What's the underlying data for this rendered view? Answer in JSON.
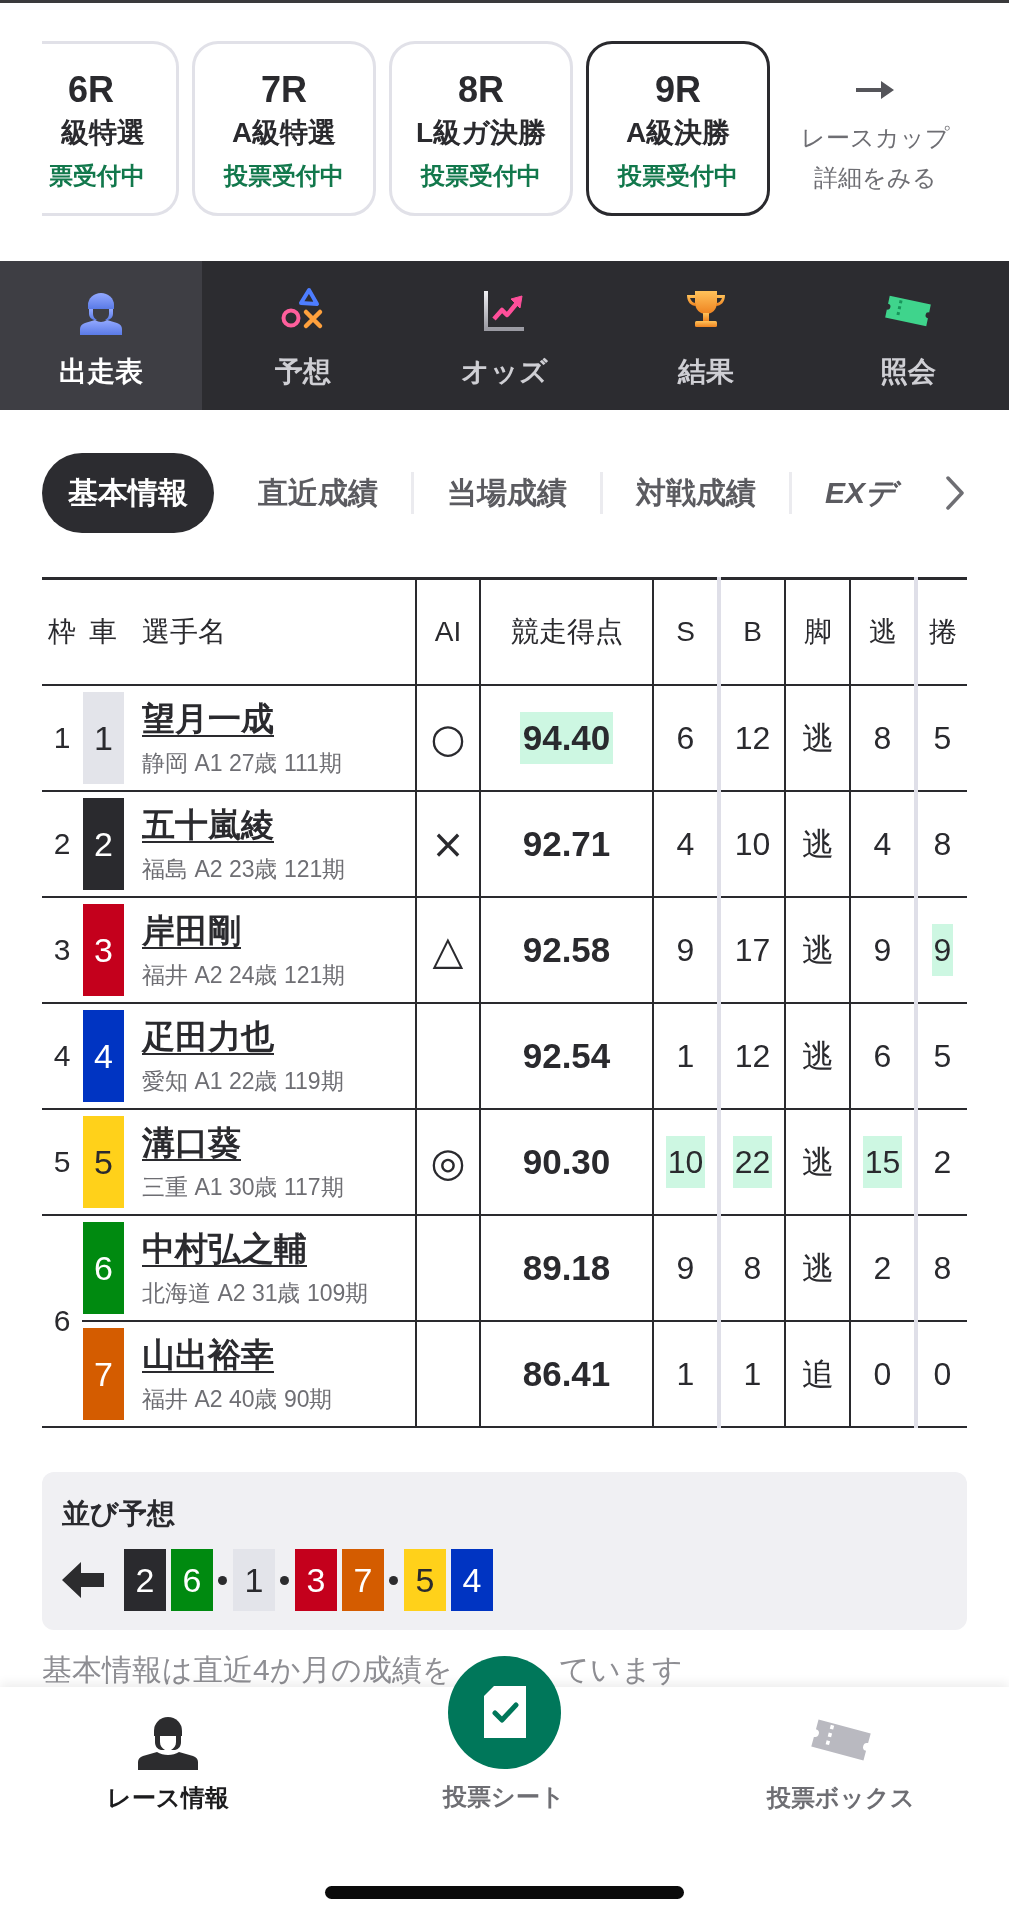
{
  "race_selector": {
    "cards": [
      {
        "race": "6R",
        "class": "級特選",
        "status": "票受付中",
        "selected": false
      },
      {
        "race": "7R",
        "class": "A級特選",
        "status": "投票受付中",
        "selected": false
      },
      {
        "race": "8R",
        "class": "L級ガ決勝",
        "status": "投票受付中",
        "selected": false
      },
      {
        "race": "9R",
        "class": "A級決勝",
        "status": "投票受付中",
        "selected": true
      }
    ],
    "link": "レースカップ詳細をみる"
  },
  "main_tabs": [
    {
      "label": "出走表",
      "selected": true
    },
    {
      "label": "予想",
      "selected": false
    },
    {
      "label": "オッズ",
      "selected": false
    },
    {
      "label": "結果",
      "selected": false
    },
    {
      "label": "照会",
      "selected": false
    }
  ],
  "sub_tabs": [
    {
      "label": "基本情報",
      "kind": "text",
      "selected": true
    },
    {
      "label": "直近成績",
      "kind": "text",
      "selected": false
    },
    {
      "label": "当場成績",
      "kind": "text",
      "selected": false
    },
    {
      "label": "対戦成績",
      "kind": "text",
      "selected": false
    },
    {
      "label": "EXデ",
      "kind": "brand",
      "selected": false
    }
  ],
  "entry_table": {
    "columns": [
      "枠",
      "車",
      "選手名",
      "AI",
      "競走得点",
      "S",
      "B",
      "脚",
      "逃",
      "捲"
    ],
    "frames": [
      {
        "frame": "1",
        "entries": [
          {
            "car": "1",
            "color": "#e3e4ea",
            "name": "望月一成",
            "profile": "静岡 A1 27歳 111期",
            "ai": "○",
            "score": {
              "text": "94.40",
              "highlighted": true
            },
            "stats": [
              {
                "text": "6",
                "highlighted": false
              },
              {
                "text": "12",
                "highlighted": false
              },
              {
                "text": "逃",
                "highlighted": false
              },
              {
                "text": "8",
                "highlighted": false
              },
              {
                "text": "5",
                "highlighted": false
              }
            ]
          }
        ]
      },
      {
        "frame": "2",
        "entries": [
          {
            "car": "2",
            "color": "#2a2a2e",
            "name": "五十嵐綾",
            "profile": "福島 A2 23歳 121期",
            "ai": "×",
            "score": {
              "text": "92.71",
              "highlighted": false
            },
            "stats": [
              {
                "text": "4",
                "highlighted": false
              },
              {
                "text": "10",
                "highlighted": false
              },
              {
                "text": "逃",
                "highlighted": false
              },
              {
                "text": "4",
                "highlighted": false
              },
              {
                "text": "8",
                "highlighted": false
              }
            ]
          }
        ]
      },
      {
        "frame": "3",
        "entries": [
          {
            "car": "3",
            "color": "#c4001c",
            "name": "岸田剛",
            "profile": "福井 A2 24歳 121期",
            "ai": "△",
            "score": {
              "text": "92.58",
              "highlighted": false
            },
            "stats": [
              {
                "text": "9",
                "highlighted": false
              },
              {
                "text": "17",
                "highlighted": false
              },
              {
                "text": "逃",
                "highlighted": false
              },
              {
                "text": "9",
                "highlighted": false
              },
              {
                "text": "9",
                "highlighted": true
              }
            ]
          }
        ]
      },
      {
        "frame": "4",
        "entries": [
          {
            "car": "4",
            "color": "#0034c2",
            "name": "疋田力也",
            "profile": "愛知 A1 22歳 119期",
            "score": {
              "text": "92.54",
              "highlighted": false
            },
            "stats": [
              {
                "text": "1",
                "highlighted": false
              },
              {
                "text": "12",
                "highlighted": false
              },
              {
                "text": "逃",
                "highlighted": false
              },
              {
                "text": "6",
                "highlighted": false
              },
              {
                "text": "5",
                "highlighted": false
              }
            ]
          }
        ]
      },
      {
        "frame": "5",
        "entries": [
          {
            "car": "5",
            "color": "#ffd11a",
            "name": "溝口葵",
            "profile": "三重 A1 30歳 117期",
            "ai": "◎",
            "score": {
              "text": "90.30",
              "highlighted": false
            },
            "stats": [
              {
                "text": "10",
                "highlighted": true
              },
              {
                "text": "22",
                "highlighted": true
              },
              {
                "text": "逃",
                "highlighted": false
              },
              {
                "text": "15",
                "highlighted": true
              },
              {
                "text": "2",
                "highlighted": false
              }
            ]
          }
        ]
      },
      {
        "frame": "6",
        "entries": [
          {
            "car": "6",
            "color": "#008a10",
            "name": "中村弘之輔",
            "profile": "北海道 A2 31歳 109期",
            "score": {
              "text": "89.18",
              "highlighted": false
            },
            "stats": [
              {
                "text": "9",
                "highlighted": false
              },
              {
                "text": "8",
                "highlighted": false
              },
              {
                "text": "逃",
                "highlighted": false
              },
              {
                "text": "2",
                "highlighted": false
              },
              {
                "text": "8",
                "highlighted": false
              }
            ]
          },
          {
            "car": "7",
            "color": "#d45c00",
            "name": "山出裕幸",
            "profile": "福井 A2 40歳 90期",
            "score": {
              "text": "86.41",
              "highlighted": false
            },
            "stats": [
              {
                "text": "1",
                "highlighted": false
              },
              {
                "text": "1",
                "highlighted": false
              },
              {
                "text": "追",
                "highlighted": false
              },
              {
                "text": "0",
                "highlighted": false
              },
              {
                "text": "0",
                "highlighted": false
              }
            ]
          }
        ]
      }
    ]
  },
  "line_prediction": {
    "title": "並び予想",
    "groups": [
      [
        {
          "car": "2",
          "color": "#2a2a2e"
        },
        {
          "car": "6",
          "color": "#008a10"
        }
      ],
      [
        {
          "car": "1",
          "color": "#e3e4ea"
        }
      ],
      [
        {
          "car": "3",
          "color": "#c4001c"
        },
        {
          "car": "7",
          "color": "#d45c00"
        }
      ],
      [
        {
          "car": "5",
          "color": "#ffd11a"
        },
        {
          "car": "4",
          "color": "#0034c2"
        }
      ]
    ]
  },
  "footnote": {
    "parts": [
      "基本情報は直近4か月の成績を",
      "ています"
    ]
  },
  "bottom_nav": [
    {
      "label": "レース情報",
      "kind": "tab",
      "selected": true
    },
    {
      "label": "投票シート",
      "kind": "floating",
      "selected": false
    },
    {
      "label": "投票ボックス",
      "kind": "tab",
      "selected": false
    }
  ]
}
